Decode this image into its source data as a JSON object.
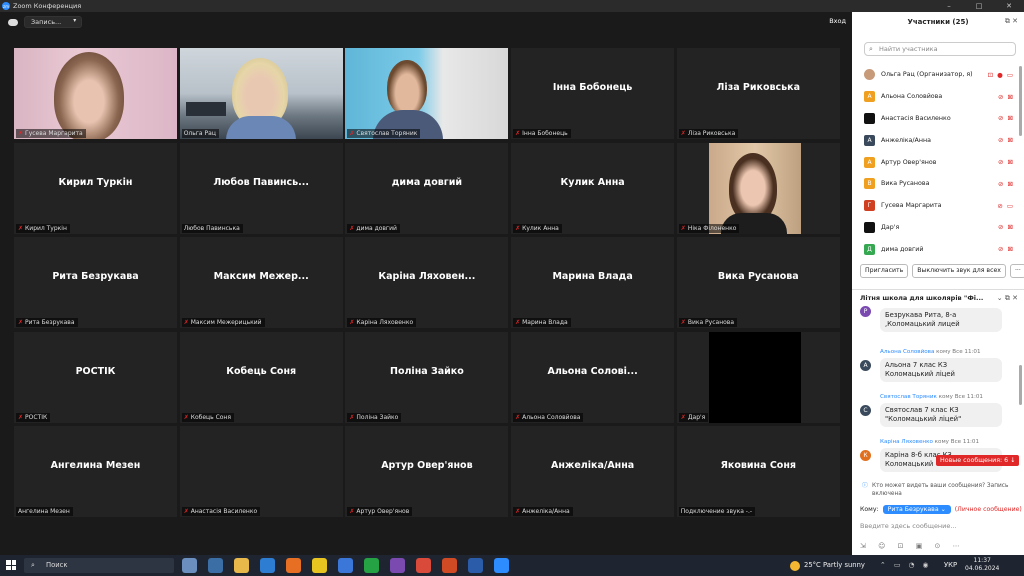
{
  "window": {
    "title": "Zoom Конференция",
    "logo_text": "zm",
    "min": "–",
    "max": "□",
    "close": "✕"
  },
  "topbar": {
    "record_label": "Запись...",
    "exit_label": "Вход"
  },
  "tiles": [
    {
      "name": "Гусева Маргарита",
      "big": "",
      "video": "girl1",
      "muted": true
    },
    {
      "name": "Ольга Рац",
      "big": "",
      "video": "teacher",
      "muted": false,
      "active": true
    },
    {
      "name": "Святослав Торяник",
      "big": "",
      "video": "boy",
      "muted": true
    },
    {
      "name": "Інна Бобонець",
      "big": "Інна Бобонець",
      "video": "",
      "muted": true
    },
    {
      "name": "Ліза Риковська",
      "big": "Ліза Риковська",
      "video": "",
      "muted": true
    },
    {
      "name": "Кирил Туркін",
      "big": "Кирил Туркін",
      "video": "",
      "muted": true
    },
    {
      "name": "Любов Павинська",
      "big": "Любов  Павинсь...",
      "video": "",
      "muted": false
    },
    {
      "name": "дима довгий",
      "big": "дима довгий",
      "video": "",
      "muted": true
    },
    {
      "name": "Кулик Анна",
      "big": "Кулик Анна",
      "video": "",
      "muted": true
    },
    {
      "name": "Ніка Філоненко",
      "big": "",
      "video": "girl2",
      "muted": true
    },
    {
      "name": "Рита Безрукава",
      "big": "Рита Безрукава",
      "video": "",
      "muted": true
    },
    {
      "name": "Максим Межерицький",
      "big": "Максим  Межер...",
      "video": "",
      "muted": true
    },
    {
      "name": "Каріна Ляховенко",
      "big": "Каріна  Ляховен...",
      "video": "",
      "muted": true
    },
    {
      "name": "Марина Влада",
      "big": "Марина Влада",
      "video": "",
      "muted": true
    },
    {
      "name": "Вика Русанова",
      "big": "Вика Русанова",
      "video": "",
      "muted": true
    },
    {
      "name": "РОСТІК",
      "big": "РОСТІК",
      "video": "",
      "muted": true
    },
    {
      "name": "Кобець Соня",
      "big": "Кобець Соня",
      "video": "",
      "muted": true
    },
    {
      "name": "Поліна Зайко",
      "big": "Поліна Зайко",
      "video": "",
      "muted": true
    },
    {
      "name": "Альона Соловйова",
      "big": "Альона  Солові...",
      "video": "",
      "muted": true
    },
    {
      "name": "Дар'я",
      "big": "",
      "video": "black",
      "muted": true
    },
    {
      "name": "Ангелина Мезен",
      "big": "Ангелина Мезен",
      "video": "",
      "muted": false
    },
    {
      "name": "Анастасія Василенко",
      "big": "",
      "video": "",
      "muted": true
    },
    {
      "name": "Артур Овер'янов",
      "big": "Артур Овер'янов",
      "video": "",
      "muted": true
    },
    {
      "name": "Анжеліка/Анна",
      "big": "Анжеліка/Анна",
      "video": "",
      "muted": true
    },
    {
      "name": "Подключение звука -.-",
      "big": "Яковина Соня",
      "video": "",
      "muted": false
    }
  ],
  "participants": {
    "title": "Участники (25)",
    "search_placeholder": "Найти участника",
    "list": [
      {
        "initial": "",
        "name": "Ольга Рац (Организатор, я)",
        "color": "#c79a7a",
        "icons": "⊡ ● ▭"
      },
      {
        "initial": "А",
        "name": "Альона Соловйова",
        "color": "#f0a020",
        "icons": "⊘ ⊠"
      },
      {
        "initial": "",
        "name": "Анастасія Василенко",
        "color": "#111111",
        "icons": "⊘ ⊠"
      },
      {
        "initial": "А",
        "name": "Анжеліка/Анна",
        "color": "#3a4a5c",
        "icons": "⊘ ⊠"
      },
      {
        "initial": "А",
        "name": "Артур Овер'янов",
        "color": "#f0a020",
        "icons": "⊘ ⊠"
      },
      {
        "initial": "В",
        "name": "Вика Русанова",
        "color": "#f0a020",
        "icons": "⊘ ⊠"
      },
      {
        "initial": "Г",
        "name": "Гусева Маргарита",
        "color": "#d04020",
        "icons": "⊘ ▭"
      },
      {
        "initial": "",
        "name": "Дар'я",
        "color": "#111111",
        "icons": "⊘ ⊠"
      },
      {
        "initial": "Д",
        "name": "дима довгий",
        "color": "#36a852",
        "icons": "⊘ ⊠"
      }
    ],
    "invite_label": "Пригласить",
    "mute_all_label": "Выключить звук для всех",
    "more_label": "···"
  },
  "chat": {
    "title": "Літня школа для школярів \"Фі...",
    "messages": [
      {
        "initial": "Р",
        "color": "#7a4ab0",
        "meta_who": "",
        "meta_rest": "",
        "text": "Безрукава Рита, 8-а ,Коломацький лицей"
      },
      {
        "initial": "А",
        "color": "#3a4a5c",
        "meta_who": "Альона Соловйова",
        "meta_rest": " кому Все 11:01",
        "text": "Альона 7 клас КЗ Коломацький ліцей"
      },
      {
        "initial": "С",
        "color": "#3a4a5c",
        "meta_who": "Святослав Торяник",
        "meta_rest": " кому Все 11:01",
        "text": "Святослав 7 клас КЗ \"Коломацький ліцей\""
      },
      {
        "initial": "К",
        "color": "#e07020",
        "meta_who": "Каріна Ляховенко",
        "meta_rest": " кому Все 11:01",
        "text": "Каріна 8-б клас КЗ Коломацький"
      }
    ],
    "new_messages": "Новые сообщения: 6 ↓",
    "note": "Кто может видеть ваши сообщения? Запись включена",
    "to_label": "Кому:",
    "recipient": "Рита Безрукава ⌄",
    "private_label": "(Личное сообщение)",
    "input_placeholder": "Введите здесь сообщение...",
    "tools": "⇲ ☺ ⊡ ▣ ⊙ ⋯"
  },
  "taskbar": {
    "search_label": "Поиск",
    "weather": "25°C  Partly sunny",
    "tray": "⌃ ▭ ◔ ◉",
    "lang": "УКР",
    "time": "11:37",
    "date": "04.06.2024",
    "apps": [
      {
        "name": "widgets",
        "color": "#6b8fbf"
      },
      {
        "name": "files",
        "color": "#3a6ea5"
      },
      {
        "name": "explorer",
        "color": "#e8b84a"
      },
      {
        "name": "store",
        "color": "#2d7dd2"
      },
      {
        "name": "firefox",
        "color": "#e76f24"
      },
      {
        "name": "chrome",
        "color": "#e8c420"
      },
      {
        "name": "mail",
        "color": "#3b77d9"
      },
      {
        "name": "whatsapp",
        "color": "#25a244"
      },
      {
        "name": "viber",
        "color": "#7a4ab0"
      },
      {
        "name": "chrome2",
        "color": "#d94a3a"
      },
      {
        "name": "powerpoint",
        "color": "#d04a24"
      },
      {
        "name": "word",
        "color": "#2b5caa"
      },
      {
        "name": "zoom",
        "color": "#2d8cff"
      }
    ]
  }
}
